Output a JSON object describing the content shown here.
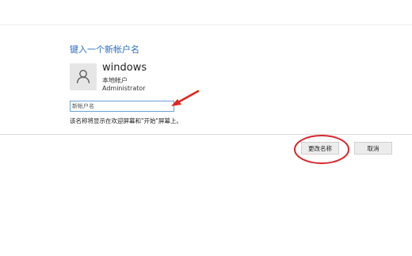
{
  "dialog": {
    "title": "键入一个新帐户名"
  },
  "account": {
    "avatar_icon": "user-silhouette-icon",
    "name": "windows",
    "type": "本地帐户",
    "role": "Administrator"
  },
  "new_name_input": {
    "placeholder": "新帐户名",
    "value": ""
  },
  "hint": "该名称将显示在欢迎屏幕和\"开始\"屏幕上。",
  "buttons": {
    "rename": "更改名称",
    "cancel": "取消"
  },
  "annotations": {
    "arrow_color": "#e0261e",
    "circle_color": "#d9262c"
  },
  "colors": {
    "title": "#2b6fc2",
    "input_border": "#6aa0d8"
  }
}
